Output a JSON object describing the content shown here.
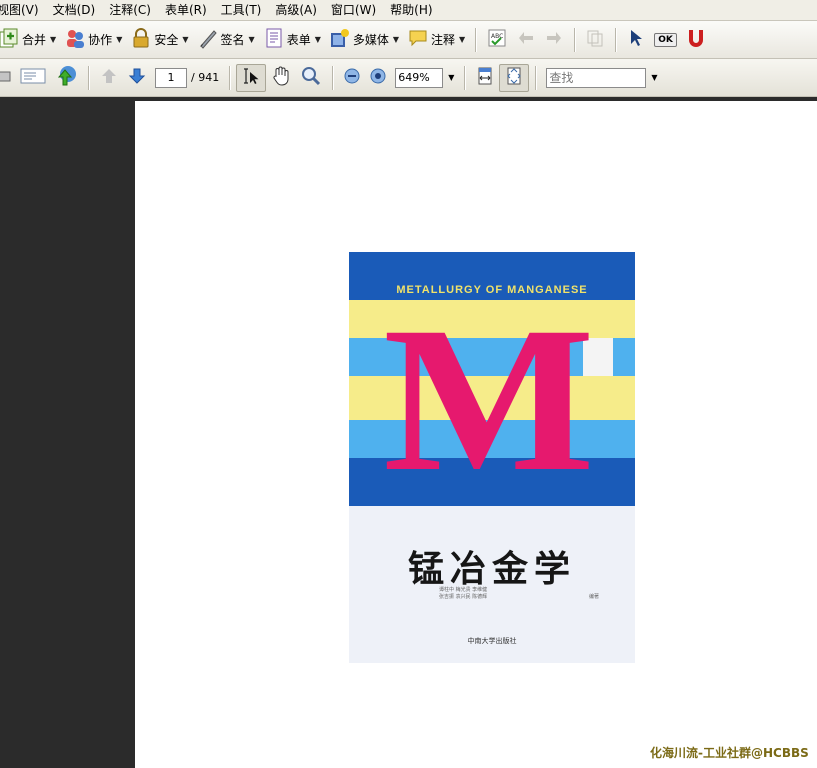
{
  "menu": [
    "视图(V)",
    "文档(D)",
    "注释(C)",
    "表单(R)",
    "工具(T)",
    "高级(A)",
    "窗口(W)",
    "帮助(H)"
  ],
  "toolbar1": {
    "combine": "合并",
    "collaborate": "协作",
    "secure": "安全",
    "sign": "签名",
    "forms": "表单",
    "multimedia": "多媒体",
    "comment": "注释",
    "ok_label": "OK"
  },
  "toolbar2": {
    "page_current": "1",
    "page_total": "/ 941",
    "zoom": "649%",
    "find_placeholder": "查找"
  },
  "cover": {
    "english_title": "METALLURGY OF MANGANESE",
    "letter": "M",
    "chinese_title": "锰冶金学",
    "authors_line1": "谭柱中  梅光贵  李维健",
    "authors_line2": "张吉振  袁兴民  陈德辉",
    "authors_suffix": "编著",
    "publisher": "中南大学出版社",
    "colors": {
      "blue": "#1a5bb8",
      "light_blue": "#4fb1ee",
      "yellow": "#f6ec8a",
      "magenta": "#e6196e"
    }
  },
  "watermark": "化海川流-工业社群@HCBBS"
}
